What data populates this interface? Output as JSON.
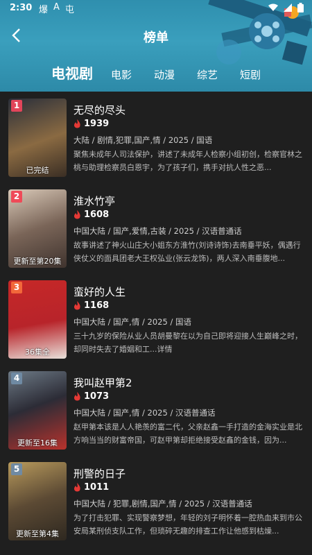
{
  "status_bar": {
    "time": "2:30",
    "app_icons": [
      "爆",
      "A",
      "屯"
    ]
  },
  "header": {
    "title": "榜单"
  },
  "tabs": [
    {
      "label": "电视剧",
      "active": true
    },
    {
      "label": "电影",
      "active": false
    },
    {
      "label": "动漫",
      "active": false
    },
    {
      "label": "综艺",
      "active": false
    },
    {
      "label": "短剧",
      "active": false
    }
  ],
  "items": [
    {
      "rank": "1",
      "rank_color": "#e2455a",
      "title": "无尽的尽头",
      "heat": "1939",
      "meta": "大陆 / 剧情,犯罪,国产,情 / 2025 / 国语",
      "desc": "聚焦未成年人司法保护，讲述了未成年人检察小组初创，检察官林之桃与助理检察员白恩宇，为了孩子们，携手对抗人性之恶...",
      "poster_label": "已完结",
      "poster_bg": "#5a4632"
    },
    {
      "rank": "2",
      "rank_color": "#ef4a58",
      "title": "淮水竹亭",
      "heat": "1608",
      "meta": "中国大陆 / 国产,爱情,古装 / 2025 / 汉语普通话",
      "desc": "故事讲述了神火山庄大小姐东方淮竹(刘诗诗饰)去南垂平妖，偶遇行侠仗义的面具团老大王权弘业(张云龙饰)，两人深入南垂腹地...",
      "poster_label": "更新至第20集",
      "poster_bg": "#6b5a52"
    },
    {
      "rank": "3",
      "rank_color": "#f2683a",
      "title": "蛮好的人生",
      "heat": "1168",
      "meta": "中国大陆 / 国产,情 / 2025 / 国语",
      "desc": "三十九岁的保险从业人员胡曼黎在以为自己即将迎接人生巅峰之时，却同时失去了婚姻和工...详情",
      "poster_label": "36集全",
      "poster_bg": "#b8242a"
    },
    {
      "rank": "4",
      "rank_color": "#6f8aa3",
      "title": "我叫赵甲第2",
      "heat": "1073",
      "meta": "中国大陆 / 国产,情 / 2025 / 汉语普通话",
      "desc": "赵甲第本该是人人艳羡的富二代，父亲赵鑫一手打造的金海实业是北方响当当的财富帝国，可赵甲第却拒绝接受赵鑫的金钱，因为...",
      "poster_label": "更新至16集",
      "poster_bg": "#3c3c46"
    },
    {
      "rank": "5",
      "rank_color": "#6f8aa3",
      "title": "刑警的日子",
      "heat": "1011",
      "meta": "中国大陆 / 犯罪,剧情,国产,情 / 2025 / 汉语普通话",
      "desc": "为了打击犯罪、实现警察梦想，年轻的刘子明怀着一腔热血来到市公安局某刑侦支队工作，但琐碎无趣的排查工作让他感到枯燥...",
      "poster_label": "更新至第4集",
      "poster_bg": "#5c4a34"
    }
  ]
}
